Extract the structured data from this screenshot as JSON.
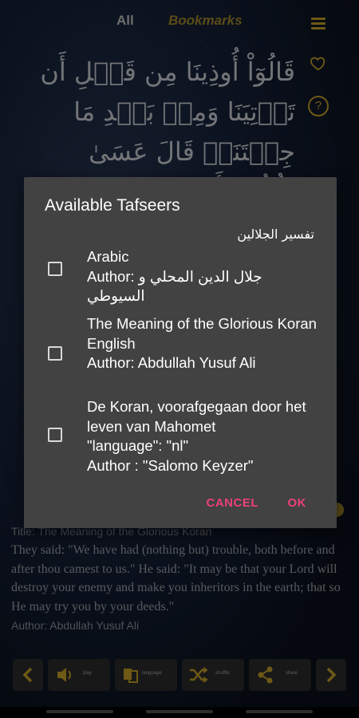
{
  "tabs": {
    "all": "All",
    "bookmarks": "Bookmarks"
  },
  "ayah_text": "قَالُوٓاْ أُوذِينَا مِن قَبۡلِ أَن تَأۡتِيَنَا وَمِنۢ بَعۡدِ مَا جِئۡتَنَاۚ قَالَ عَسَىٰ رَبُّكُمۡ أَن يُهۡلِكَ",
  "dialog": {
    "title": "Available Tafseers",
    "arabic_tafsir_name": "تفسير الجلالين",
    "options": [
      {
        "line1": "Arabic",
        "line2": "Author:  جلال الدين المحلي و السيوطي",
        "checked": false
      },
      {
        "line1": "The Meaning of the Glorious Koran",
        "line2": "English",
        "line3": "Author: Abdullah Yusuf Ali",
        "checked": false
      },
      {
        "line1": "De Koran, voorafgegaan door het leven van Mahomet",
        "line2": "\"language\": \"nl\"",
        "line3": "Author : \"Salomo Keyzer\"",
        "checked": false
      }
    ],
    "cancel_label": "CANCEL",
    "ok_label": "OK"
  },
  "translation": {
    "title": "Title: The Meaning of the Glorious Koran",
    "text": "They said: \"We have had (nothing but) trouble, both before and after thou camest to us.\" He said: \"It may be that your Lord will destroy your enemy and make you inheritors in the earth; that so He may try you by your deeds.\"",
    "author": "Author: Abdullah Yusuf Ali"
  },
  "toolbar": {
    "play": "play",
    "language": "language",
    "shuffle": "shuffle",
    "share": "share"
  },
  "colors": {
    "accent": "#c9a227",
    "dialog_button": "#ec407a",
    "dialog_bg": "#424242"
  }
}
